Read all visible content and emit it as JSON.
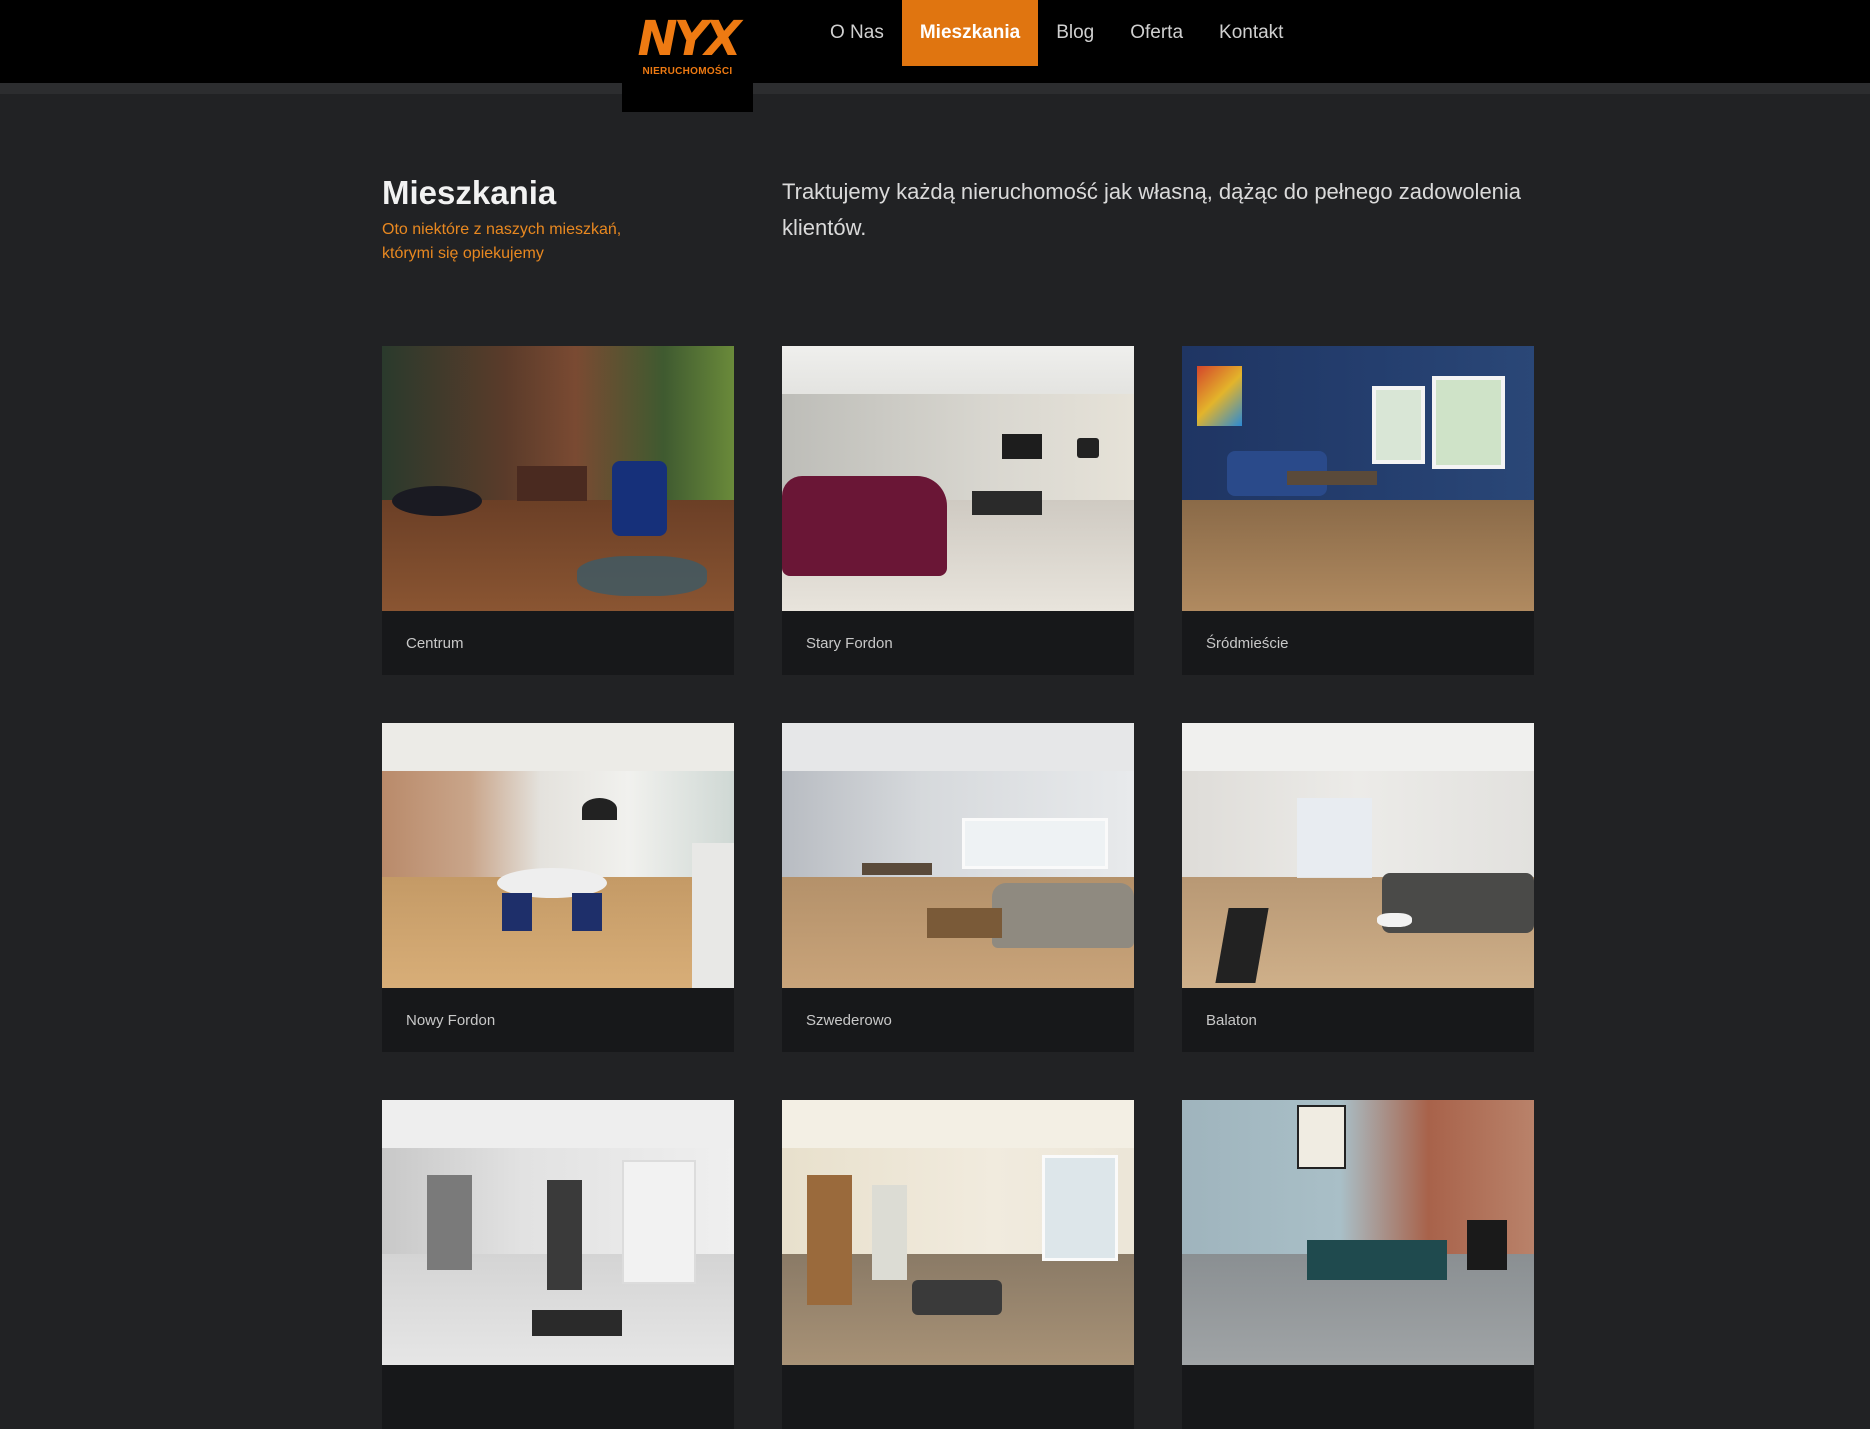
{
  "brand": {
    "logo_text": "NYX",
    "logo_subtext": "NIERUCHOMOŚCI",
    "accent_color": "#e07510"
  },
  "nav": {
    "items": [
      {
        "label": "O Nas",
        "active": false
      },
      {
        "label": "Mieszkania",
        "active": true
      },
      {
        "label": "Blog",
        "active": false
      },
      {
        "label": "Oferta",
        "active": false
      },
      {
        "label": "Kontakt",
        "active": false
      }
    ]
  },
  "intro": {
    "title": "Mieszkania",
    "subtitle": "Oto niektóre z naszych mieszkań, którymi się opiekujemy",
    "lead": "Traktujemy każdą nieruchomość jak własną, dążąc do pełnego zadowolenia klientów."
  },
  "apartments": [
    {
      "name": "Centrum"
    },
    {
      "name": "Stary Fordon"
    },
    {
      "name": "Śródmieście"
    },
    {
      "name": "Nowy Fordon"
    },
    {
      "name": "Szwederowo"
    },
    {
      "name": "Balaton"
    },
    {
      "name": ""
    },
    {
      "name": ""
    },
    {
      "name": ""
    }
  ]
}
